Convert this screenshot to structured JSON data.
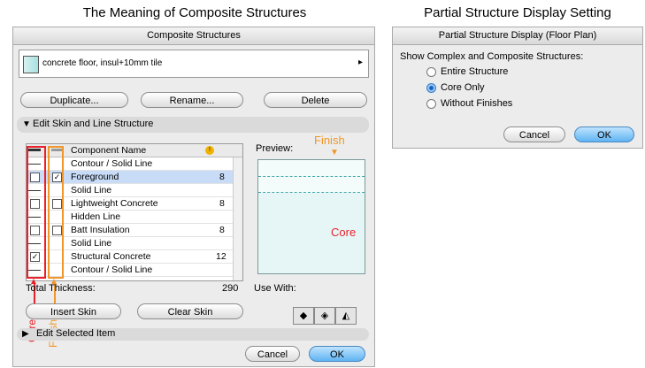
{
  "titles": {
    "left": "The Meaning of Composite Structures",
    "right": "Partial Structure Display Setting"
  },
  "composite": {
    "window_title": "Composite Structures",
    "selected_item": "concrete floor, insul+10mm tile",
    "buttons": {
      "duplicate": "Duplicate...",
      "rename": "Rename...",
      "delete": "Delete"
    },
    "section_edit": "Edit Skin and Line Structure",
    "table": {
      "header": "Component Name",
      "rows": [
        {
          "name": "Contour / Solid Line",
          "value": ""
        },
        {
          "name": "Foreground",
          "value": "8"
        },
        {
          "name": "Solid Line",
          "value": ""
        },
        {
          "name": "Lightweight Concrete",
          "value": "8"
        },
        {
          "name": "Hidden Line",
          "value": ""
        },
        {
          "name": "Batt Insulation",
          "value": "8"
        },
        {
          "name": "Solid Line",
          "value": ""
        },
        {
          "name": "Structural Concrete",
          "value": "12"
        },
        {
          "name": "Contour / Solid Line",
          "value": ""
        }
      ]
    },
    "preview_label": "Preview:",
    "finish_label": "Finish",
    "core_label": "Core",
    "total_label": "Total Thickness:",
    "total_value": "290",
    "use_with_label": "Use With:",
    "insert_skin": "Insert Skin",
    "clear_skin": "Clear Skin",
    "section_selected": "Edit Selected Item",
    "cancel": "Cancel",
    "ok": "OK",
    "overlay_core": "Core",
    "overlay_finish": "Finish"
  },
  "partial": {
    "window_title": "Partial Structure Display (Floor Plan)",
    "prompt": "Show Complex and Composite Structures:",
    "options": [
      "Entire Structure",
      "Core Only",
      "Without Finishes"
    ],
    "selected": "Core Only",
    "cancel": "Cancel",
    "ok": "OK"
  },
  "colors": {
    "core": "#e8212b",
    "finish": "#f0962a",
    "accent": "#5fb3f2"
  }
}
